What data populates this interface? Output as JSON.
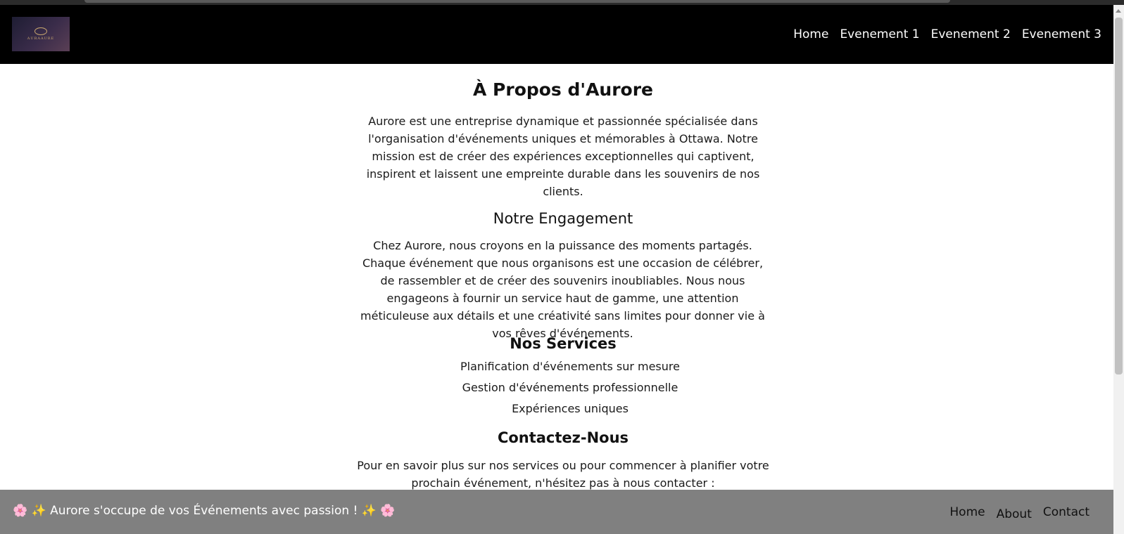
{
  "navbar": {
    "logo_text": "AURAAURE",
    "links": [
      "Home",
      "Evenement 1",
      "Evenement 2",
      "Evenement 3"
    ]
  },
  "about": {
    "title": "À Propos d'Aurore",
    "intro": "Aurore est une entreprise dynamique et passionnée spécialisée dans l'organisation d'événements uniques et mémorables à Ottawa. Notre mission est de créer des expériences exceptionnelles qui captivent, inspirent et laissent une empreinte durable dans les souvenirs de nos clients.",
    "engagement_title": "Notre Engagement",
    "engagement_text": "Chez Aurore, nous croyons en la puissance des moments partagés. Chaque événement que nous organisons est une occasion de célébrer, de rassembler et de créer des souvenirs inoubliables. Nous nous engageons à fournir un service haut de gamme, une attention méticuleuse aux détails et une créativité sans limites pour donner vie à vos rêves d'événements.",
    "services_title": "Nos Services",
    "services": [
      "Planification d'événements sur mesure",
      "Gestion d'événements professionnelle",
      "Expériences uniques"
    ],
    "contact_title": "Contactez-Nous",
    "contact_text": "Pour en savoir plus sur nos services ou pour commencer à planifier votre prochain événement, n'hésitez pas à nous contacter :"
  },
  "footer": {
    "tagline": "🌸 ✨ Aurore s'occupe de vos Événements avec passion ! ✨ 🌸",
    "links": [
      "Home",
      "About",
      "Contact"
    ]
  },
  "colors": {
    "navbar_bg": "#000000",
    "footer_bg": "#808080"
  }
}
